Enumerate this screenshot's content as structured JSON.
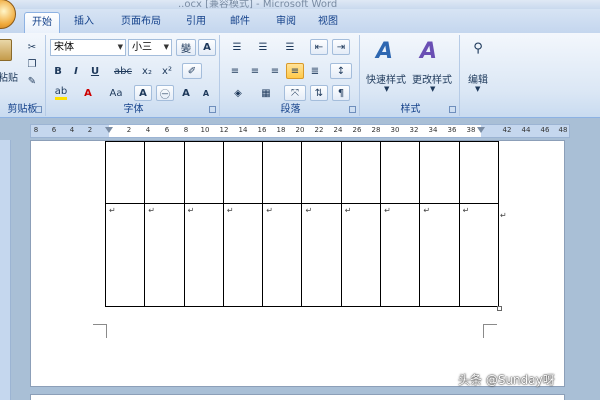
{
  "window": {
    "title": "..ocx [兼容模式] - Microsoft Word"
  },
  "tabs": [
    "开始",
    "插入",
    "页面布局",
    "引用",
    "邮件",
    "审阅",
    "视图"
  ],
  "clipboard": {
    "paste_label": "粘贴",
    "group_label": "剪贴板"
  },
  "font_group": {
    "font_name": "宋体",
    "font_size": "小三",
    "grow_label": "A",
    "shrink_label": "A",
    "wen_label": "變",
    "bold": "B",
    "italic": "I",
    "underline": "U",
    "strike": "abc",
    "subscript": "x₂",
    "superscript": "x²",
    "font_color": "A",
    "case": "Aa",
    "char_border": "A",
    "enclose": "㊀",
    "group_label": "字体"
  },
  "paragraph_group": {
    "group_label": "段落"
  },
  "styles_group": {
    "quick_styles_label": "快速样式",
    "change_styles_label": "更改样式",
    "group_label": "样式"
  },
  "editing_group": {
    "label": "编辑"
  },
  "ruler": {
    "left_numbers": [
      "8",
      "6",
      "4",
      "2"
    ],
    "right_numbers": [
      "2",
      "4",
      "6",
      "8",
      "10",
      "12",
      "14",
      "16",
      "18",
      "20",
      "22",
      "24",
      "26",
      "28",
      "30",
      "32",
      "34",
      "36",
      "38",
      "",
      "42",
      "44",
      "46",
      "48"
    ]
  },
  "table": {
    "columns": 10,
    "cell_mark": "↵"
  },
  "watermark": "头条 @Sunday呀",
  "colors": {
    "ribbon_bg": "#dbe7f5",
    "accent": "#15428b",
    "active_tab_border": "#8db2e3"
  }
}
